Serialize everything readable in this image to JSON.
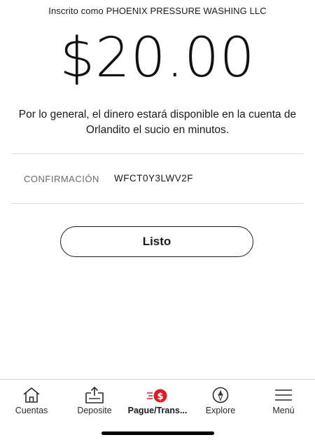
{
  "header": {
    "enrolled_text": "Inscrito como PHOENIX PRESSURE WASHING LLC"
  },
  "payment": {
    "amount": "$20.00",
    "message": "Por lo general, el dinero estará disponible en la cuenta de Orlandito el sucio en minutos."
  },
  "confirmation": {
    "label": "CONFIRMACIÓN",
    "code": "WFCT0Y3LWV2F"
  },
  "actions": {
    "done_label": "Listo"
  },
  "tabbar": {
    "active_color": "#d71e28",
    "items": [
      {
        "label": "Cuentas",
        "icon": "home-icon"
      },
      {
        "label": "Deposite",
        "icon": "deposit-icon"
      },
      {
        "label": "Pague/Trans...",
        "icon": "pay-transfer-icon",
        "active": true
      },
      {
        "label": "Explore",
        "icon": "compass-icon"
      },
      {
        "label": "Menú",
        "icon": "menu-icon"
      }
    ]
  }
}
